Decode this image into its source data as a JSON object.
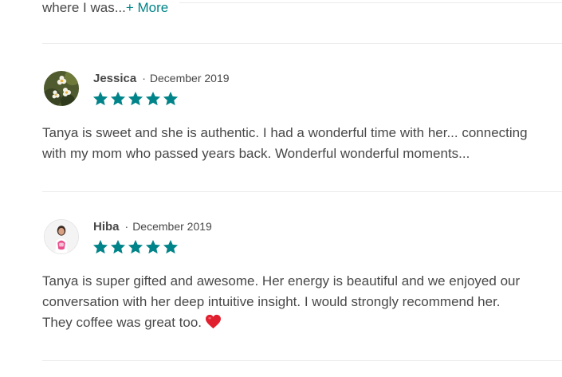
{
  "previous_review": {
    "truncated_text": "where I was...",
    "more_link": "+ More"
  },
  "reviews": [
    {
      "name": "Jessica",
      "separator": "·",
      "date": "December 2019",
      "rating": 5,
      "text_lines": [
        "Tanya is sweet and she is authentic. I had a wonderful time with her... connecting",
        "with my mom who passed years back. Wonderful wonderful moments..."
      ],
      "avatar_icon": "flower-photo-avatar"
    },
    {
      "name": "Hiba",
      "separator": "·",
      "date": "December 2019",
      "rating": 5,
      "text_lines": [
        "Tanya is super gifted and awesome. Her energy is beautiful and we enjoyed our",
        "conversation with her deep intuitive insight. I would strongly recommend her.",
        "They coffee was great too."
      ],
      "trailing_emoji": "red-heart-icon",
      "avatar_icon": "person-photo-avatar"
    }
  ],
  "colors": {
    "accent": "#008489",
    "text": "#484848",
    "divider": "#ebebeb",
    "heart": "#e0202e"
  }
}
